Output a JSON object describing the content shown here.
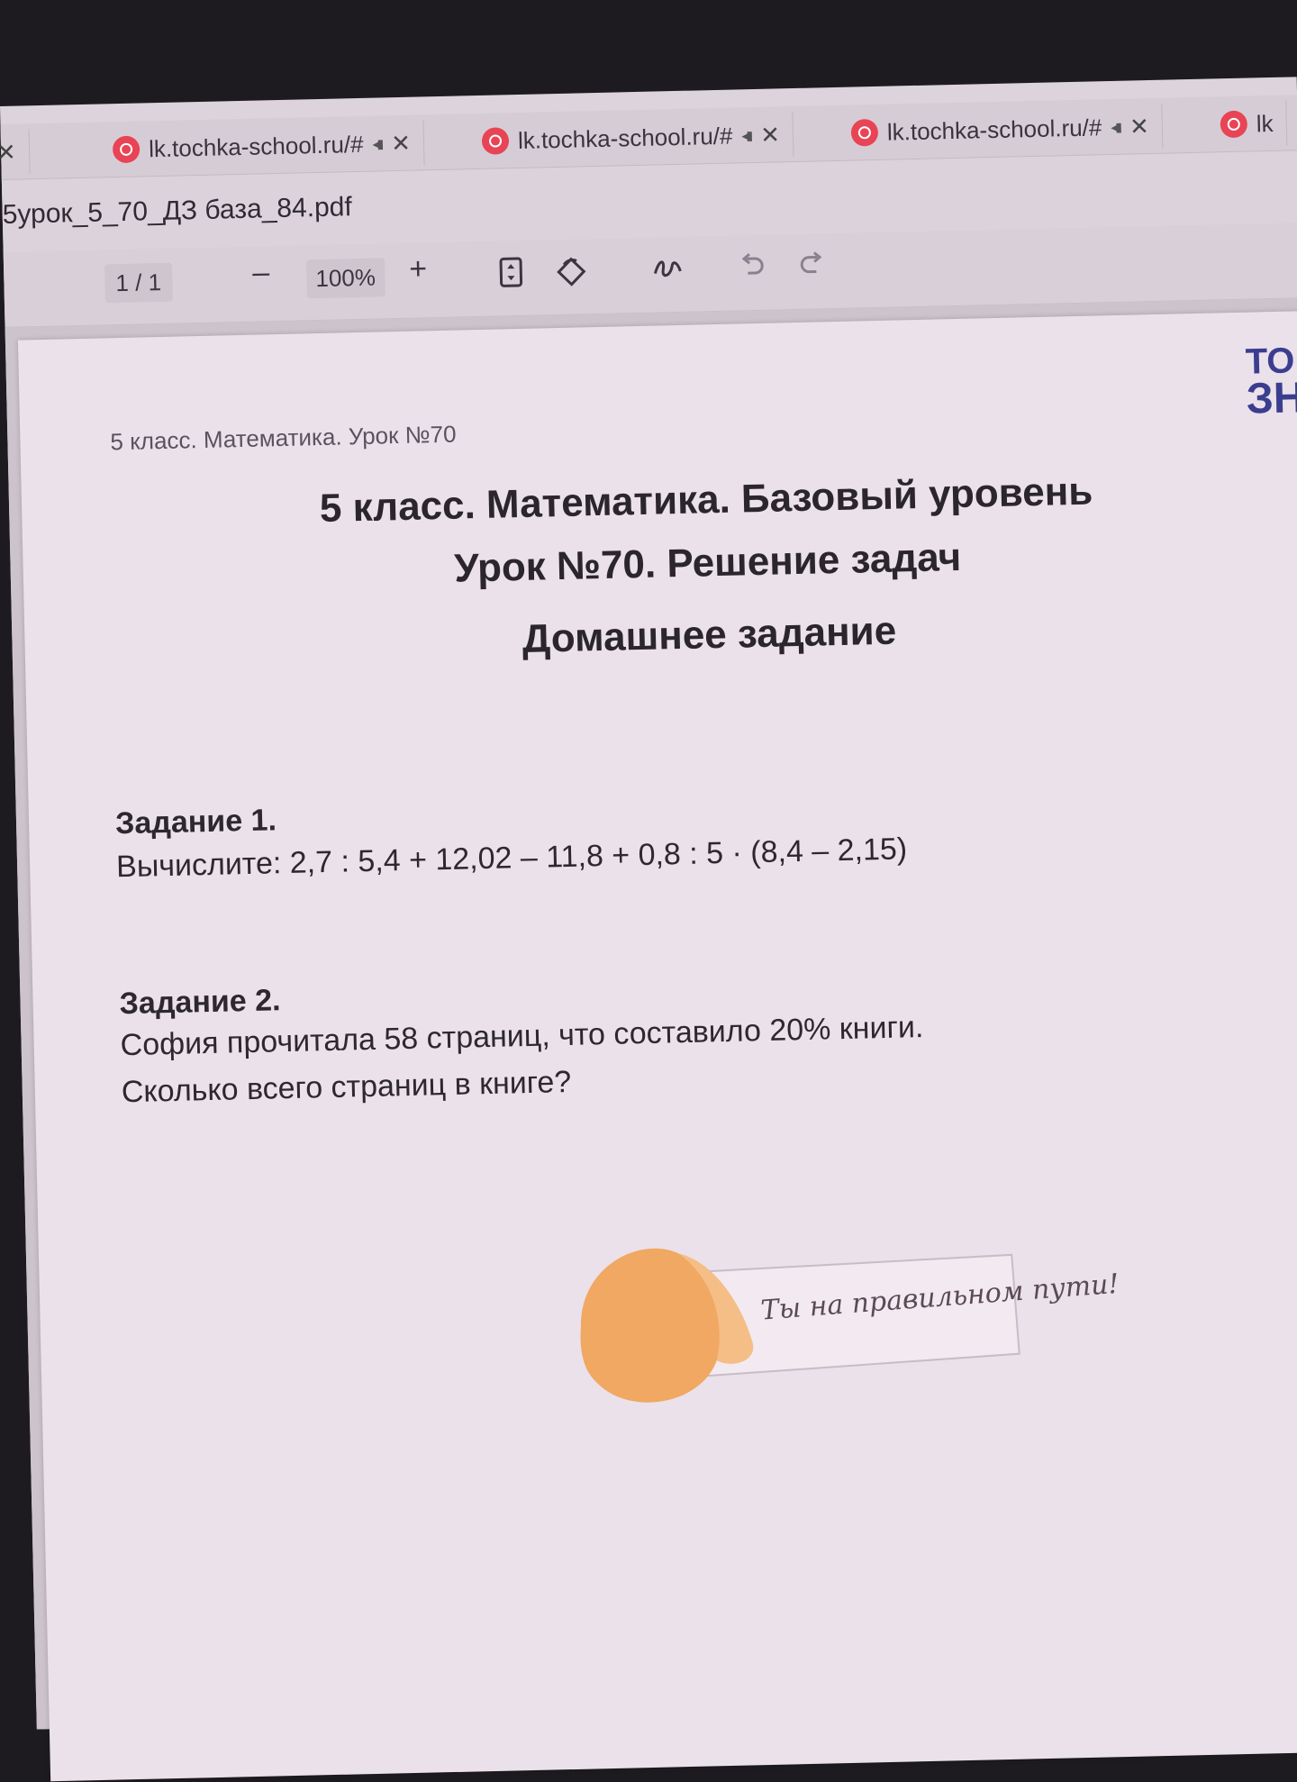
{
  "browser": {
    "tabs": [
      {
        "url": "",
        "audio": "◂▮",
        "close": "✕"
      },
      {
        "url": "lk.tochka-school.ru/#",
        "audio": "◂▮",
        "close": "✕"
      },
      {
        "url": "lk.tochka-school.ru/#",
        "audio": "◂▮",
        "close": "✕"
      },
      {
        "url": "lk.tochka-school.ru/#",
        "audio": "◂▮",
        "close": "✕"
      },
      {
        "url": "lk",
        "audio": "",
        "close": ""
      }
    ],
    "favicon_color": "#e84455"
  },
  "file": {
    "title": "5урок_5_70_ДЗ база_84.pdf"
  },
  "toolbar": {
    "page_counter": "1 / 1",
    "zoom_out": "–",
    "zoom_level": "100%",
    "zoom_in": "+",
    "icons": [
      "fit-page-icon",
      "rotate-icon",
      "draw-icon",
      "undo-icon",
      "redo-icon"
    ]
  },
  "document": {
    "header": "5 класс. Математика. Урок №70",
    "logo_line1": "ТО",
    "logo_line2": "ЗН",
    "title_line1": "5 класс. Математика. Базовый уровень",
    "title_line2": "Урок №70. Решение задач",
    "title_line3": "Домашнее задание",
    "task1_heading": "Задание 1.",
    "task1_text": "Вычислите: 2,7 : 5,4 + 12,02 – 11,8 + 0,8 : 5 · (8,4 – 2,15)",
    "task2_heading": "Задание 2.",
    "task2_line1": "София прочитала 58 страниц, что составило 20% книги.",
    "task2_line2": "Сколько всего страниц в книге?",
    "motto": "Ты на правильном пути!",
    "brand_blue": "#3b3e8f",
    "brand_red": "#e34a5b",
    "cookie_color": "#f0a862"
  }
}
